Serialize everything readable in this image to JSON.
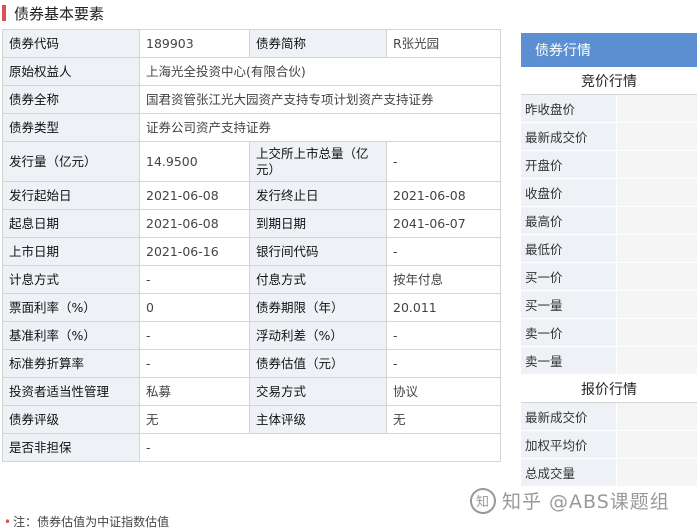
{
  "page": {
    "title": "债券基本要素",
    "footnote": "注：债券估值为中证指数估值",
    "watermark": "知乎 @ABS课题组"
  },
  "basic_info": {
    "rows": [
      {
        "cells": [
          {
            "type": "label",
            "text": "债券代码"
          },
          {
            "type": "value",
            "text": "189903"
          },
          {
            "type": "label",
            "text": "债券简称"
          },
          {
            "type": "value",
            "text": "R张光园"
          }
        ]
      },
      {
        "cells": [
          {
            "type": "label",
            "text": "原始权益人"
          },
          {
            "type": "value",
            "text": "上海光全投资中心(有限合伙)",
            "span": 3
          }
        ]
      },
      {
        "cells": [
          {
            "type": "label",
            "text": "债券全称"
          },
          {
            "type": "value",
            "text": "国君资管张江光大园资产支持专项计划资产支持证券",
            "span": 3
          }
        ]
      },
      {
        "cells": [
          {
            "type": "label",
            "text": "债券类型"
          },
          {
            "type": "value",
            "text": "证券公司资产支持证券",
            "span": 3
          }
        ]
      },
      {
        "tall": true,
        "cells": [
          {
            "type": "label",
            "text": "发行量（亿元）"
          },
          {
            "type": "value",
            "text": "14.9500"
          },
          {
            "type": "label",
            "text": "上交所上市总量（亿元）"
          },
          {
            "type": "value",
            "text": "-"
          }
        ]
      },
      {
        "cells": [
          {
            "type": "label",
            "text": "发行起始日"
          },
          {
            "type": "value",
            "text": "2021-06-08"
          },
          {
            "type": "label",
            "text": "发行终止日"
          },
          {
            "type": "value",
            "text": "2021-06-08"
          }
        ]
      },
      {
        "cells": [
          {
            "type": "label",
            "text": "起息日期"
          },
          {
            "type": "value",
            "text": "2021-06-08"
          },
          {
            "type": "label",
            "text": "到期日期"
          },
          {
            "type": "value",
            "text": "2041-06-07"
          }
        ]
      },
      {
        "cells": [
          {
            "type": "label",
            "text": "上市日期"
          },
          {
            "type": "value",
            "text": "2021-06-16"
          },
          {
            "type": "label",
            "text": "银行间代码"
          },
          {
            "type": "value",
            "text": "-"
          }
        ]
      },
      {
        "cells": [
          {
            "type": "label",
            "text": "计息方式"
          },
          {
            "type": "value",
            "text": "-"
          },
          {
            "type": "label",
            "text": "付息方式"
          },
          {
            "type": "value",
            "text": "按年付息"
          }
        ]
      },
      {
        "cells": [
          {
            "type": "label",
            "text": "票面利率（%）"
          },
          {
            "type": "value",
            "text": "0"
          },
          {
            "type": "label",
            "text": "债券期限（年）"
          },
          {
            "type": "value",
            "text": "20.011"
          }
        ]
      },
      {
        "cells": [
          {
            "type": "label",
            "text": "基准利率（%）"
          },
          {
            "type": "value",
            "text": "-"
          },
          {
            "type": "label",
            "text": "浮动利差（%）"
          },
          {
            "type": "value",
            "text": "-"
          }
        ]
      },
      {
        "cells": [
          {
            "type": "label",
            "text": "标准券折算率"
          },
          {
            "type": "value",
            "text": "-"
          },
          {
            "type": "label",
            "text": "债券估值（元）"
          },
          {
            "type": "value",
            "text": "-"
          }
        ]
      },
      {
        "cells": [
          {
            "type": "label",
            "text": "投资者适当性管理"
          },
          {
            "type": "value",
            "text": "私募"
          },
          {
            "type": "label",
            "text": "交易方式"
          },
          {
            "type": "value",
            "text": "协议"
          }
        ]
      },
      {
        "cells": [
          {
            "type": "label",
            "text": "债券评级"
          },
          {
            "type": "value",
            "text": "无"
          },
          {
            "type": "label",
            "text": "主体评级"
          },
          {
            "type": "value",
            "text": "无"
          }
        ]
      },
      {
        "cells": [
          {
            "type": "label",
            "text": "是否非担保"
          },
          {
            "type": "value",
            "text": "-",
            "span": 3
          }
        ]
      }
    ]
  },
  "quote_panel": {
    "header": "债券行情",
    "sections": [
      {
        "title": "竞价行情",
        "rows": [
          "昨收盘价",
          "最新成交价",
          "开盘价",
          "收盘价",
          "最高价",
          "最低价",
          "买一价",
          "买一量",
          "卖一价",
          "卖一量"
        ]
      },
      {
        "title": "报价行情",
        "rows": [
          "最新成交价",
          "加权平均价",
          "总成交量"
        ]
      }
    ]
  },
  "colors": {
    "accent_red": "#d9534f",
    "panel_header_blue": "#5b8fd1",
    "label_bg": "#eef1f5",
    "border": "#d4d4d4"
  }
}
